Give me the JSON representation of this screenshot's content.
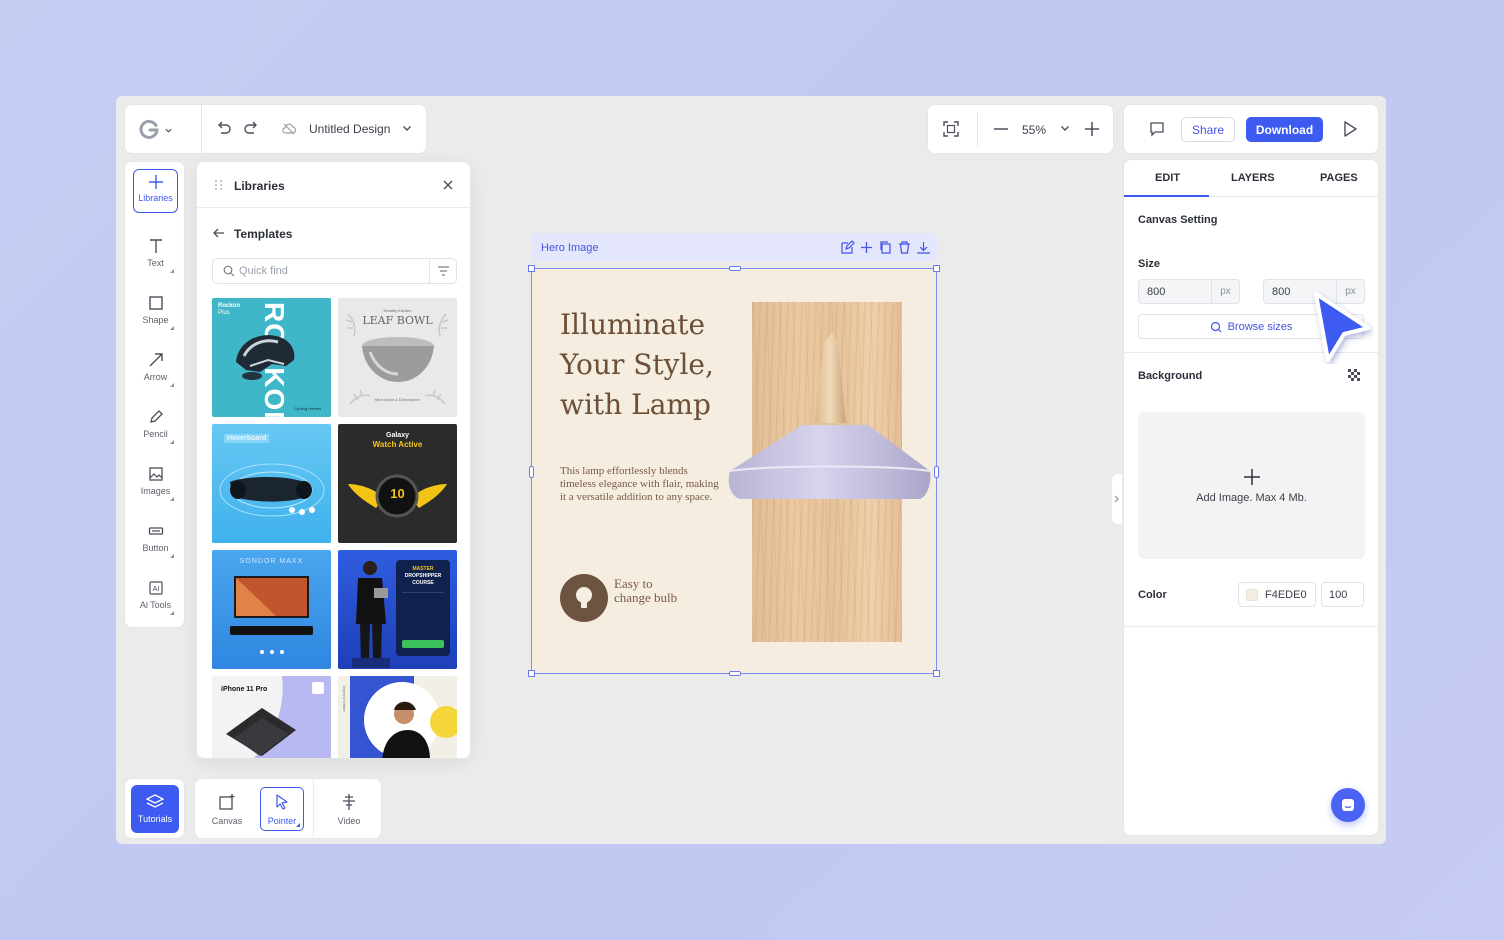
{
  "topbar": {
    "doc_title": "Untitled Design",
    "zoom": "55%",
    "share_label": "Share",
    "download_label": "Download"
  },
  "tools": [
    {
      "label": "Libraries",
      "icon": "plus-icon"
    },
    {
      "label": "Text",
      "icon": "text-icon"
    },
    {
      "label": "Shape",
      "icon": "square-icon"
    },
    {
      "label": "Arrow",
      "icon": "arrow-icon"
    },
    {
      "label": "Pencil",
      "icon": "pencil-icon"
    },
    {
      "label": "Images",
      "icon": "image-icon"
    },
    {
      "label": "Button",
      "icon": "button-icon"
    },
    {
      "label": "Ai Tools",
      "icon": "ai-icon"
    }
  ],
  "libraries": {
    "title": "Libraries",
    "section": "Templates",
    "search_placeholder": "Quick find",
    "templates": [
      {
        "name": "helmet",
        "texts": [
          "Rockon",
          "Plus",
          "ROCKON",
          "Cycling Helmet"
        ],
        "bg": "#3fb7c9"
      },
      {
        "name": "leaf-bowl",
        "texts": [
          "Healthy Kitchen",
          "LEAF BOWL",
          "Microwave & Dishwasher"
        ],
        "bg": "#e9e9ea"
      },
      {
        "name": "hoverboard",
        "texts": [
          "Hoverboard"
        ],
        "bg": "#56c0f0"
      },
      {
        "name": "watch",
        "texts": [
          "Galaxy",
          "Watch Active",
          "10"
        ],
        "bg": "#2b2b2b"
      },
      {
        "name": "soundbar",
        "texts": [
          "SONDOR MAXX"
        ],
        "bg": "#3b95e6"
      },
      {
        "name": "course",
        "texts": [
          "MASTER",
          "DROPSHIPPER",
          "COURSE"
        ],
        "bg": "#2e58d8"
      },
      {
        "name": "iphone",
        "texts": [
          "iPhone 11 Pro"
        ],
        "bg": "#f3f3f6"
      },
      {
        "name": "woman",
        "texts": [
          "Improve better"
        ],
        "bg": "#f2f0e6"
      }
    ]
  },
  "canvas": {
    "frame_label": "Hero Image",
    "headline": "Illuminate Your Style, with Lamp",
    "body": "This lamp effortlessly blends timeless elegance with  flair, making it a versatile addition to any space.",
    "bulb_text": "Easy to change bulb"
  },
  "right_panel": {
    "tabs": [
      "EDIT",
      "LAYERS",
      "PAGES"
    ],
    "active_tab": "EDIT",
    "canvas_setting": "Canvas Setting",
    "size_label": "Size",
    "width": "800",
    "height": "800",
    "unit": "px",
    "browse_sizes": "Browse sizes",
    "background_label": "Background",
    "add_image": "Add Image. Max 4 Mb.",
    "color_label": "Color",
    "color_hex": "F4EDE0",
    "opacity": "100"
  },
  "bottom": {
    "tutorials": "Tutorials",
    "modes": [
      "Canvas",
      "Pointer",
      "Video"
    ],
    "active_mode": "Pointer"
  },
  "colors": {
    "accent": "#3d5af1",
    "artboard_bg": "#f4ede0",
    "lamp_text": "#6b4f36"
  }
}
